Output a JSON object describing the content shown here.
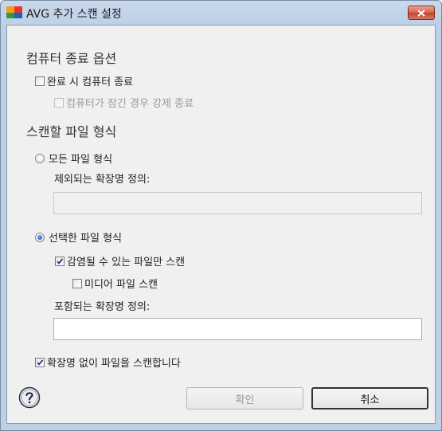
{
  "window": {
    "title": "AVG 추가 스캔 설정"
  },
  "shutdown": {
    "section_title": "컴퓨터 종료 옵션",
    "shutdown_on_complete": {
      "label": "완료 시 컴퓨터 종료",
      "checked": false
    },
    "force_if_locked": {
      "label": "컴퓨터가 잠긴 경우 강제 종료",
      "checked": false,
      "enabled": false
    }
  },
  "file_types": {
    "section_title": "스캔할 파일 형식",
    "all_types": {
      "label": "모든 파일 형식",
      "selected": false
    },
    "exclude_label": "제외되는 확장명 정의:",
    "exclude_value": "",
    "selected_types": {
      "label": "선택한 파일 형식",
      "selected": true
    },
    "infectable_only": {
      "label": "감염될 수 있는 파일만 스캔",
      "checked": true
    },
    "media_files": {
      "label": "미디어 파일 스캔",
      "checked": false
    },
    "include_label": "포함되는 확장명 정의:",
    "include_value": "",
    "no_extension": {
      "label": "확장명 없이 파일을 스캔합니다",
      "checked": true
    }
  },
  "buttons": {
    "help_icon": "question-mark-icon",
    "ok": "확인",
    "cancel": "취소"
  },
  "colors": {
    "title_gradient_top": "#c9d9ec",
    "client_bg": "#f0f0f0",
    "close_red": "#c2412c",
    "radio_blue": "#1c57b8"
  }
}
